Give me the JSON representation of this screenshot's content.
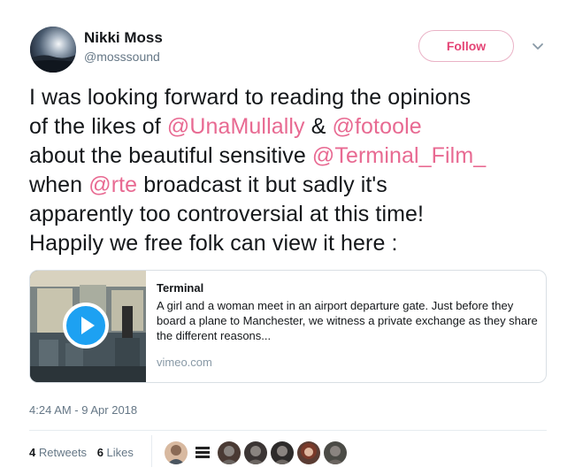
{
  "author": {
    "name": "Nikki Moss",
    "handle": "@mosssound"
  },
  "follow_button": {
    "label": "Follow"
  },
  "tweet": {
    "lines": [
      [
        {
          "t": "I was looking forward to reading the opinions",
          "m": false
        }
      ],
      [
        {
          "t": "of the likes of ",
          "m": false
        },
        {
          "t": "@UnaMullally",
          "m": true
        },
        {
          "t": " & ",
          "m": false
        },
        {
          "t": "@fotoole",
          "m": true
        }
      ],
      [
        {
          "t": "about the beautiful sensitive ",
          "m": false
        },
        {
          "t": "@Terminal_Film_",
          "m": true
        }
      ],
      [
        {
          "t": "when ",
          "m": false
        },
        {
          "t": "@rte",
          "m": true
        },
        {
          "t": " broadcast it but sadly it's",
          "m": false
        }
      ],
      [
        {
          "t": "apparently too controversial at this time!",
          "m": false
        }
      ],
      [
        {
          "t": "Happily we free folk can view it here :",
          "m": false
        }
      ]
    ]
  },
  "card": {
    "title": "Terminal",
    "description": "A girl and a woman meet in an airport departure gate. Just before they board a plane to Manchester, we witness a private exchange as they share the different reasons...",
    "domain": "vimeo.com"
  },
  "timestamp": "4:24 AM - 9 Apr 2018",
  "stats": {
    "retweets_count": "4",
    "retweets_label": "Retweets",
    "likes_count": "6",
    "likes_label": "Likes"
  },
  "likers": [
    {
      "icon": "avatar-man-icon",
      "color": "#d8b9a0"
    },
    {
      "icon": "fight-back-films-logo-icon",
      "color": "#ffffff"
    },
    {
      "icon": "avatar-dark-icon",
      "color": "#4a3a34"
    },
    {
      "icon": "avatar-dark-icon",
      "color": "#3b3534"
    },
    {
      "icon": "avatar-dark-icon",
      "color": "#2d2b2a"
    },
    {
      "icon": "avatar-woman-icon",
      "color": "#5a3c33"
    },
    {
      "icon": "avatar-dark-icon",
      "color": "#4b4b46"
    }
  ],
  "colors": {
    "mention": "#e86a92",
    "follow": "#e0245e",
    "muted": "#657786"
  }
}
